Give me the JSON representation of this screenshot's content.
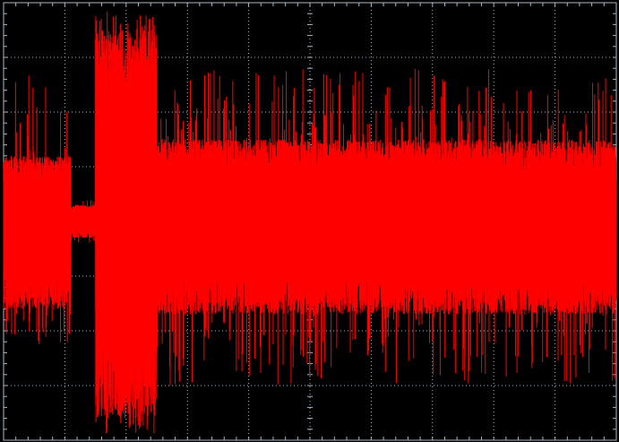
{
  "chart_data": {
    "type": "line",
    "title": "",
    "xlabel": "",
    "ylabel": "",
    "grid": true,
    "divisions": {
      "x": 10,
      "y": 8,
      "minor_per_division": 5
    },
    "xlim": [
      0,
      10
    ],
    "ylim": [
      -4,
      4
    ],
    "series": [
      {
        "name": "",
        "color": "#ff0000",
        "segments": [
          {
            "x_start": 0.0,
            "x_end": 1.1,
            "envelope_max": 1.2,
            "envelope_min": -1.6,
            "peak_max": 2.8,
            "peak_min": -2.3
          },
          {
            "x_start": 1.1,
            "x_end": 1.5,
            "envelope_max": 0.3,
            "envelope_min": -0.3,
            "peak_max": 0.4,
            "peak_min": -0.4
          },
          {
            "x_start": 1.5,
            "x_end": 2.5,
            "envelope_max": 3.5,
            "envelope_min": -3.6,
            "peak_max": 3.9,
            "peak_min": -3.9
          },
          {
            "x_start": 2.5,
            "x_end": 10.0,
            "envelope_max": 1.5,
            "envelope_min": -1.7,
            "peak_max": 2.8,
            "peak_min": -3.0
          }
        ]
      }
    ],
    "colors": {
      "background": "#000000",
      "grid": "#a9b8c8",
      "trace": "#ff0000"
    }
  }
}
